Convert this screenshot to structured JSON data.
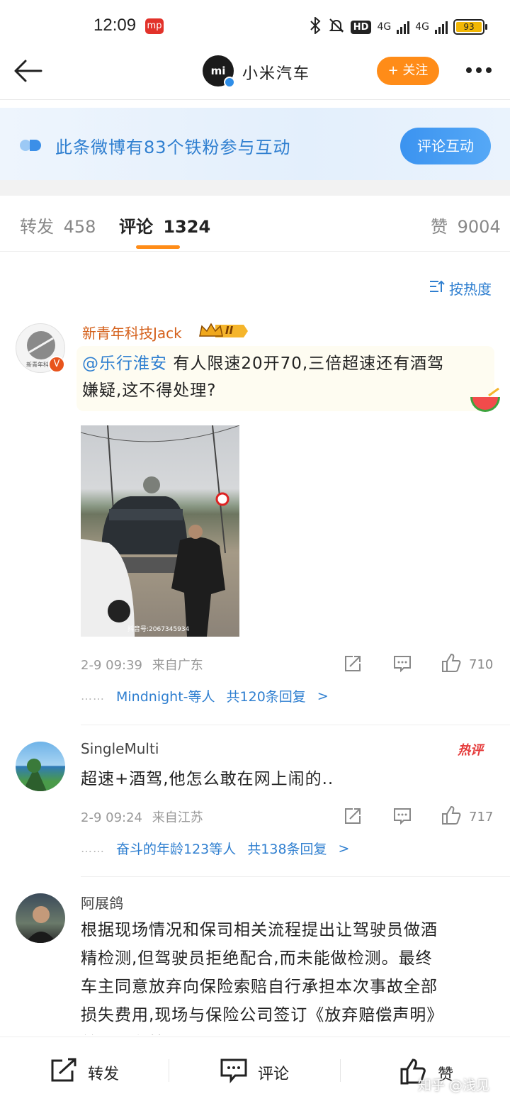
{
  "status_bar": {
    "time": "12:09",
    "app_badge": "mp",
    "hd": "HD",
    "net1": "4G",
    "net2": "4G",
    "battery": "93"
  },
  "header": {
    "account_name": "小米汽车",
    "avatar_text": "mi",
    "follow_label": "+ 关注"
  },
  "banner": {
    "text": "此条微博有83个铁粉参与互动",
    "button_label": "评论互动"
  },
  "tabs": [
    {
      "label": "转发",
      "count": "458"
    },
    {
      "label": "评论",
      "count": "1324"
    },
    {
      "label": "赞",
      "count": "9004"
    }
  ],
  "sort_label": "按热度",
  "comments": [
    {
      "user": "新青年科技Jack",
      "level_badge": "II",
      "mention": "@乐行淮安",
      "text_line1": "有人限速20开70,三倍超速还有酒驾",
      "text_line2": "嫌疑,这不得处理?",
      "avatar_caption": "新青年科",
      "image_watermark": "抖音号:2067345934",
      "time": "2-9 09:39",
      "location": "来自广东",
      "likes": "710",
      "reply_dots": "……",
      "reply_users": "Mindnight-等人",
      "reply_count": "共120条回复",
      "reply_arrow": ">"
    },
    {
      "user": "SingleMulti",
      "hot_tag": "热评",
      "text": "超速+酒驾,他怎么敢在网上闹的..",
      "time": "2-9 09:24",
      "location": "来自江苏",
      "likes": "717",
      "reply_dots": "……",
      "reply_users": "奋斗的年龄123等人",
      "reply_count": "共138条回复",
      "reply_arrow": ">"
    },
    {
      "user": "阿展鸽",
      "lines": [
        "根据现场情况和保司相关流程提出让驾驶员做酒",
        "精检测,但驾驶员拒绝配合,而未能做检测。最终",
        "车主同意放弃向保险索赔自行承担本次事故全部",
        "损失费用,现场与保险公司签订《放弃赔偿声明》",
        "并记录留档。😅😅😅"
      ]
    }
  ],
  "bottom_bar": {
    "repost": "转发",
    "comment": "评论",
    "like": "赞"
  },
  "watermark": "知乎 @浅见",
  "colors": {
    "accent_orange": "#ff8c18",
    "link_blue": "#2f7fd0",
    "vip_orange": "#d4601b"
  }
}
